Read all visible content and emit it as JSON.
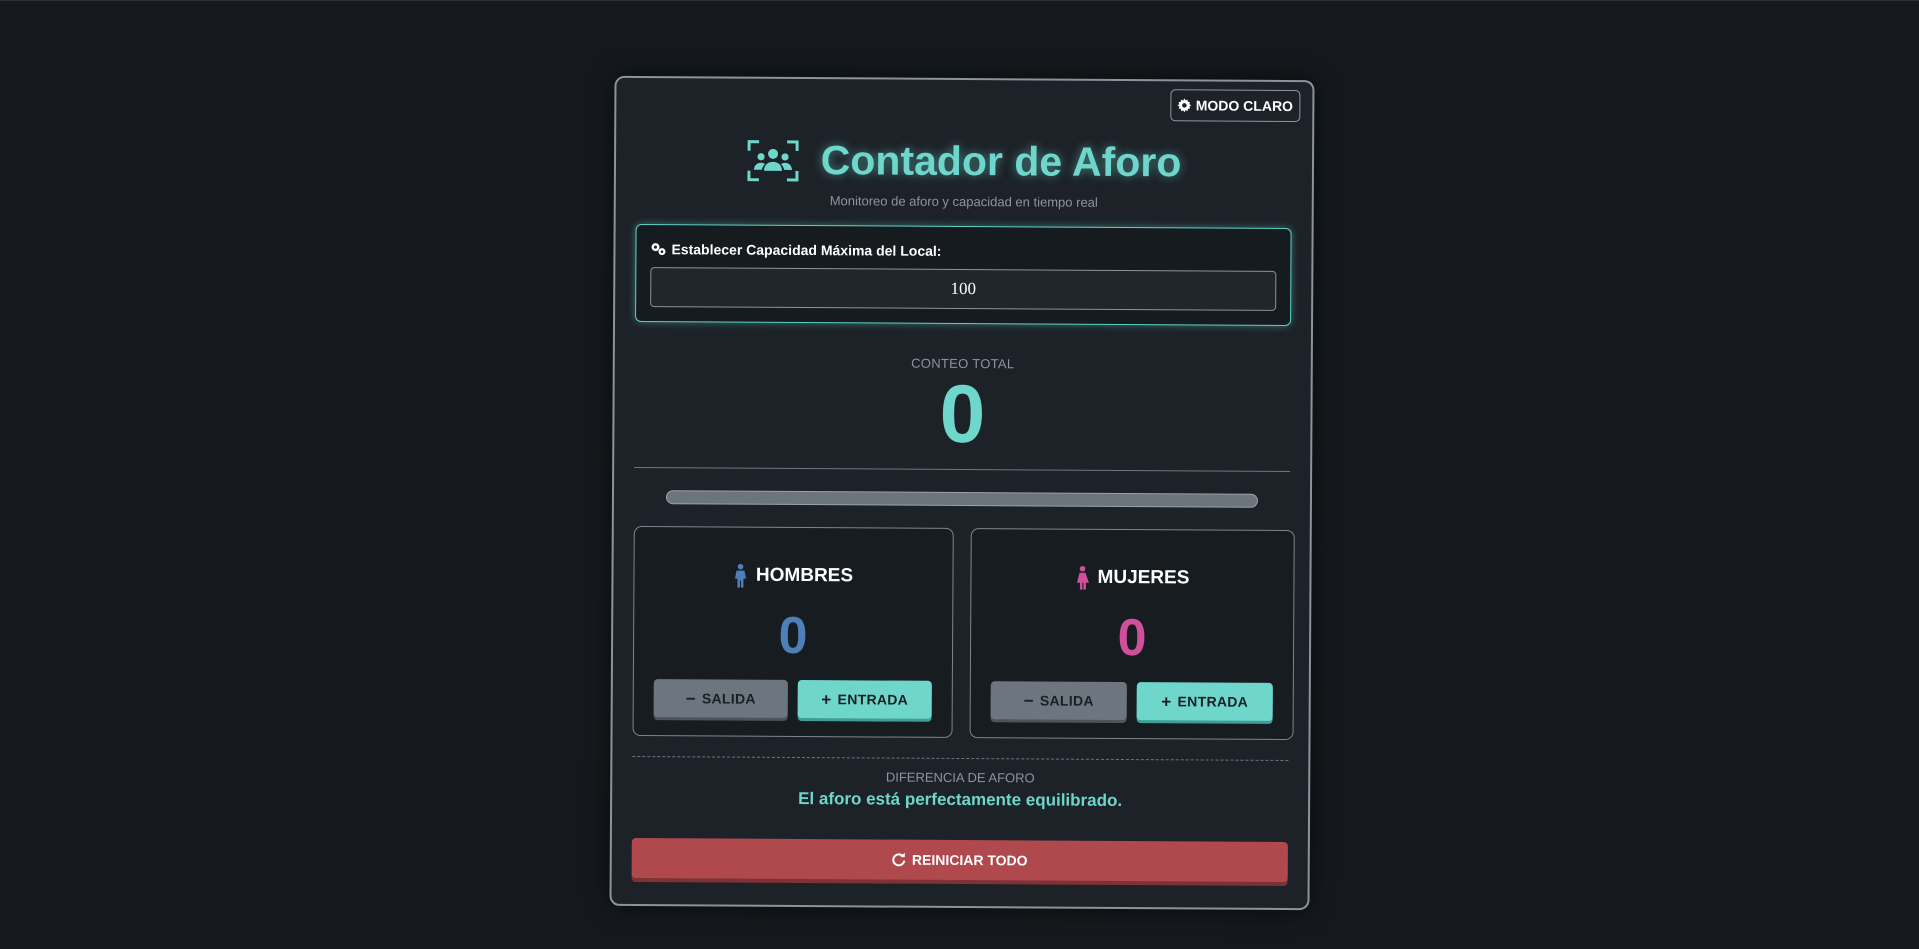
{
  "theme_toggle": {
    "label": "MODO CLARO",
    "icon": "gear-icon"
  },
  "header": {
    "title": "Contador de Aforo",
    "subtitle": "Monitoreo de aforo y capacidad en tiempo real",
    "logo_icon": "users-scan-icon"
  },
  "capacity": {
    "label": "Establecer Capacidad Máxima del Local:",
    "icon": "gears-icon",
    "value": "100"
  },
  "total": {
    "label": "CONTEO TOTAL",
    "value": "0",
    "occupancy_fraction": 0
  },
  "men": {
    "title": "HOMBRES",
    "icon": "male-person-icon",
    "count": "0",
    "exit_label": "SALIDA",
    "enter_label": "ENTRADA"
  },
  "women": {
    "title": "MUJERES",
    "icon": "female-person-icon",
    "count": "0",
    "exit_label": "SALIDA",
    "enter_label": "ENTRADA"
  },
  "difference": {
    "label": "DIFERENCIA DE AFORO",
    "message": "El aforo está perfectamente equilibrado."
  },
  "reset": {
    "label": "REINICIAR TODO",
    "icon": "redo-icon"
  },
  "colors": {
    "accent": "#6fd6cc",
    "men": "#4f7fb8",
    "women": "#cf4f9b",
    "danger": "#b0494e",
    "background": "#15191d"
  }
}
